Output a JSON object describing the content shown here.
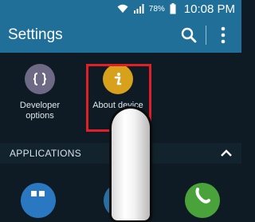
{
  "status_bar": {
    "battery_percent": "78%",
    "time": "10:08 PM",
    "icons": [
      "wifi-icon",
      "signal-icon",
      "battery-icon"
    ]
  },
  "app_bar": {
    "title": "Settings",
    "icons": [
      "search-icon",
      "more-vert-icon"
    ]
  },
  "tiles": [
    {
      "label_line1": "Developer",
      "label_line2": "options",
      "icon": "code-braces-icon",
      "color": "#6e6a86"
    },
    {
      "label": "About device",
      "icon": "info-icon",
      "color": "#d7a11b"
    }
  ],
  "section": {
    "title": "APPLICATIONS",
    "icon": "chevron-up-icon"
  },
  "bottom_icons": [
    {
      "icon": "apps-icon",
      "color": "#2b78c2"
    },
    {
      "icon": "check-icon",
      "color": "#2a6da0"
    },
    {
      "icon": "phone-icon",
      "color": "#4aa23a"
    }
  ],
  "colors": {
    "accent": "#1f6f98",
    "highlight": "#e21f26"
  }
}
